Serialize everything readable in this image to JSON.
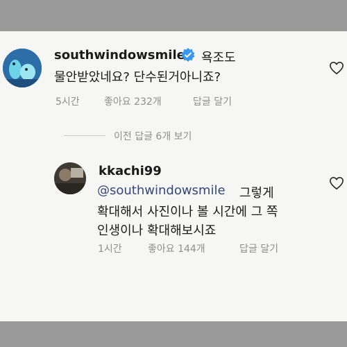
{
  "comment1": {
    "username": "southwindowsmile",
    "text_line1": "욕조도",
    "text_line2": "물안받았네요? 단수된거아니죠?",
    "time": "5시간",
    "likes": "좋아요 232개",
    "reply": "답글 달기"
  },
  "previous_replies": "이전 답글 6개 보기",
  "comment2": {
    "username": "kkachi99",
    "mention": "@southwindowsmile",
    "text_line1": "그렇게",
    "text_line2": "확대해서 사진이나 볼 시간에 그 쪽",
    "text_line3": "인생이나 확대해보시죠",
    "time": "1시간",
    "likes": "좋아요 144개",
    "reply": "답글 달기"
  },
  "icons": [
    "avatar",
    "verified-badge-icon",
    "heart-icon",
    "heart-icon"
  ],
  "colors": {
    "mention": "#32487a",
    "verified": "#3897f0",
    "meta": "#8e8e8e"
  }
}
